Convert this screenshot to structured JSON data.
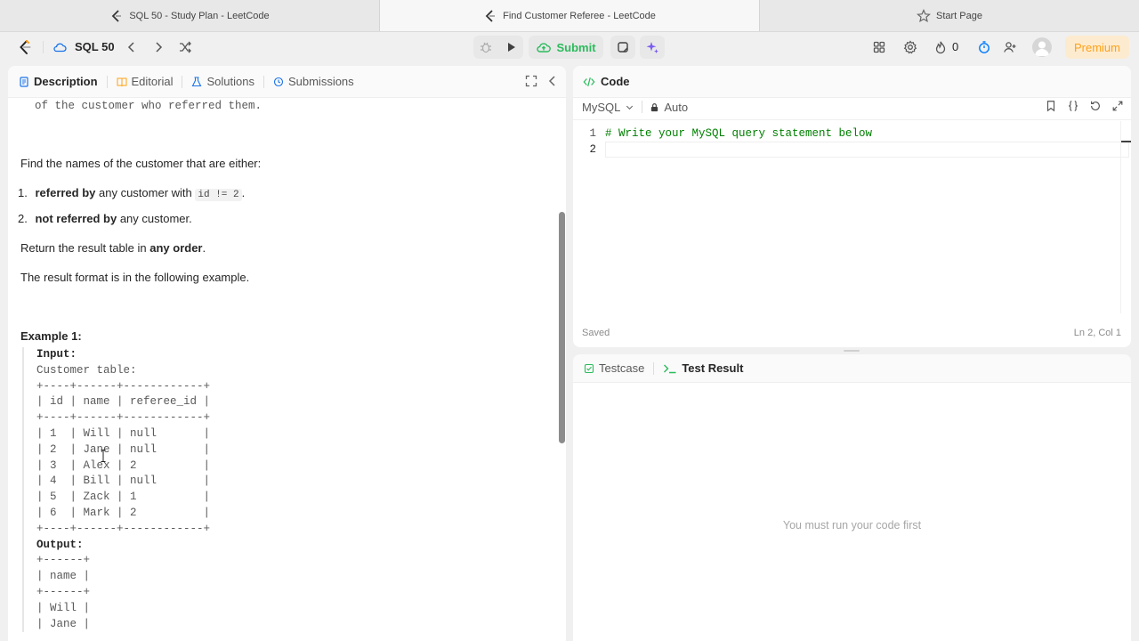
{
  "browser_tabs": [
    {
      "title": "SQL 50 - Study Plan - LeetCode",
      "icon": "leetcode-icon"
    },
    {
      "title": "Find Customer Referee - LeetCode",
      "icon": "leetcode-icon"
    },
    {
      "title": "Start Page",
      "icon": "star-icon"
    }
  ],
  "nav": {
    "study_plan": "SQL 50",
    "submit_label": "Submit",
    "streak_count": "0",
    "premium_label": "Premium"
  },
  "left_tabs": {
    "description": "Description",
    "editorial": "Editorial",
    "solutions": "Solutions",
    "submissions": "Submissions"
  },
  "description": {
    "cut_line": "of the customer who referred them.",
    "find_text": "Find the names of the customer that are either:",
    "item1_num": "1.",
    "item1_bold": "referred by",
    "item1_rest": " any customer with ",
    "item1_code": "id != 2",
    "item1_end": ".",
    "item2_num": "2.",
    "item2_bold": "not referred by",
    "item2_rest": " any customer.",
    "return_pre": "Return the result table in ",
    "return_bold": "any order",
    "return_end": ".",
    "format_text": "The result format is in the following example.",
    "example_title": "Example 1:",
    "example_lines": [
      "Input:",
      "Customer table:",
      "+----+------+------------+",
      "| id | name | referee_id |",
      "+----+------+------------+",
      "| 1  | Will | null       |",
      "| 2  | Jane | null       |",
      "| 3  | Alex | 2          |",
      "| 4  | Bill | null       |",
      "| 5  | Zack | 1          |",
      "| 6  | Mark | 2          |",
      "+----+------+------------+",
      "Output:",
      "+------+",
      "| name |",
      "+------+",
      "| Will |",
      "| Jane |"
    ]
  },
  "code_panel": {
    "title": "Code",
    "language": "MySQL",
    "mode": "Auto",
    "line1_num": "1",
    "line1_code": "# Write your MySQL query statement below",
    "line2_num": "2",
    "saved": "Saved",
    "cursor_pos": "Ln 2, Col 1"
  },
  "result_panel": {
    "testcase_tab": "Testcase",
    "result_tab": "Test Result",
    "empty_message": "You must run your code first"
  },
  "colors": {
    "submit_green": "#2cbb5d",
    "premium_orange": "#ffa116",
    "comment_green": "#008000",
    "accent_blue": "#007aff"
  }
}
